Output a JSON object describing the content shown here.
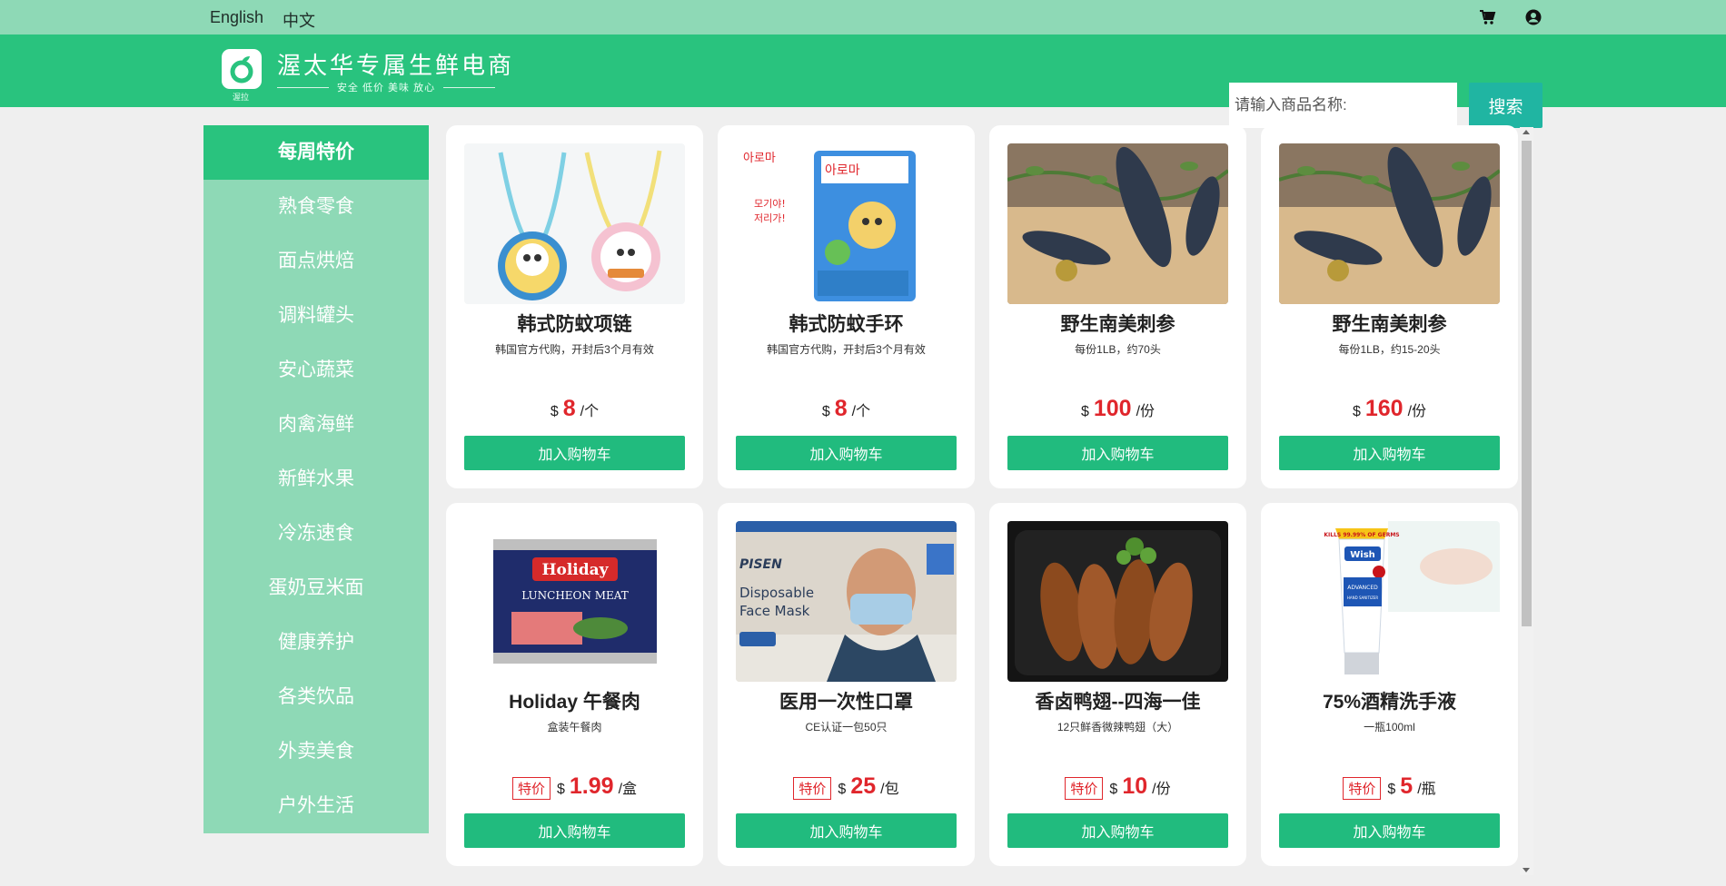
{
  "topbar": {
    "lang_english": "English",
    "lang_chinese": "中文"
  },
  "header": {
    "logo_caption": "渥拉",
    "brand_title": "渥太华专属生鲜电商",
    "brand_tagline": "安全  低价  美味  放心",
    "search_placeholder": "请输入商品名称:",
    "search_button": "搜索"
  },
  "sidebar": {
    "items": [
      {
        "label": "每周特价"
      },
      {
        "label": "熟食零食"
      },
      {
        "label": "面点烘焙"
      },
      {
        "label": "调料罐头"
      },
      {
        "label": "安心蔬菜"
      },
      {
        "label": "肉禽海鲜"
      },
      {
        "label": "新鲜水果"
      },
      {
        "label": "冷冻速食"
      },
      {
        "label": "蛋奶豆米面"
      },
      {
        "label": "健康养护"
      },
      {
        "label": "各类饮品"
      },
      {
        "label": "外卖美食"
      },
      {
        "label": "户外生活"
      }
    ]
  },
  "products": [
    {
      "name": "韩式防蚊项链",
      "desc": "韩国官方代购，开封后3个月有效",
      "currency": "$",
      "price": "8",
      "unit": "/个",
      "special": "",
      "button": "加入购物车",
      "image": "necklace"
    },
    {
      "name": "韩式防蚊手环",
      "desc": "韩国官方代购，开封后3个月有效",
      "currency": "$",
      "price": "8",
      "unit": "/个",
      "special": "",
      "button": "加入购物车",
      "image": "bracelet-pack"
    },
    {
      "name": "野生南美刺参",
      "desc": "每份1LB，约70头",
      "currency": "$",
      "price": "100",
      "unit": "/份",
      "special": "",
      "button": "加入购物车",
      "image": "sea-cucumber"
    },
    {
      "name": "野生南美刺参",
      "desc": "每份1LB，约15-20头",
      "currency": "$",
      "price": "160",
      "unit": "/份",
      "special": "",
      "button": "加入购物车",
      "image": "sea-cucumber"
    },
    {
      "name": "Holiday 午餐肉",
      "desc": "盒装午餐肉",
      "currency": "$",
      "price": "1.99",
      "unit": "/盒",
      "special": "特价",
      "button": "加入购物车",
      "image": "luncheon-meat"
    },
    {
      "name": "医用一次性口罩",
      "desc": "CE认证一包50只",
      "currency": "$",
      "price": "25",
      "unit": "/包",
      "special": "特价",
      "button": "加入购物车",
      "image": "face-mask"
    },
    {
      "name": "香卤鸭翅--四海一佳",
      "desc": "12只鲜香微辣鸭翅（大）",
      "currency": "$",
      "price": "10",
      "unit": "/份",
      "special": "特价",
      "button": "加入购物车",
      "image": "duck-wings"
    },
    {
      "name": "75%酒精洗手液",
      "desc": "一瓶100ml",
      "currency": "$",
      "price": "5",
      "unit": "/瓶",
      "special": "特价",
      "button": "加入购物车",
      "image": "hand-sanitizer"
    }
  ],
  "images": {
    "luncheon_brand": "Holiday",
    "luncheon_label": "LUNCHEON MEAT",
    "mask_brand": "PISEN",
    "mask_text_1": "Disposable",
    "mask_text_2": "Face Mask",
    "sanitizer_brand": "Wish",
    "sanitizer_text_1": "ADVANCED",
    "sanitizer_text_2": "HAND SANITIZER",
    "sanitizer_banner": "KILLS 99.99% OF GERMS"
  },
  "colors": {
    "topbar": "#8ed9b6",
    "header": "#29c37e",
    "sidebar": "#8ed9b6",
    "sidebar_active": "#29c37e",
    "search_button": "#20b5a2",
    "add_button": "#21bb7e",
    "price_red": "#e0262c"
  },
  "icons": {
    "cart": "shopping-cart-icon",
    "user": "user-circle-icon",
    "logo": "apple-logo-icon"
  }
}
